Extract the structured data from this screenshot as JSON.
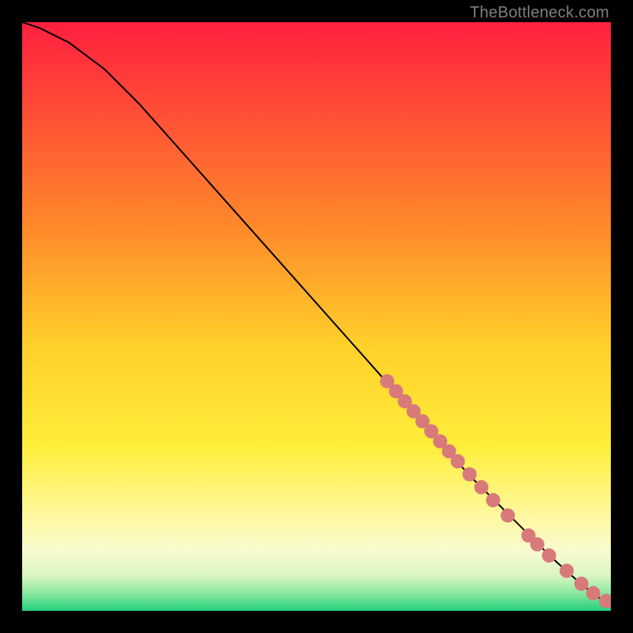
{
  "watermark": "TheBottleneck.com",
  "chart_data": {
    "type": "line",
    "title": "",
    "xlabel": "",
    "ylabel": "",
    "xlim": [
      0,
      100
    ],
    "ylim": [
      0,
      100
    ],
    "grid": false,
    "legend": false,
    "background_gradient": {
      "stops": [
        {
          "offset": 0,
          "color": "#ff1f3f"
        },
        {
          "offset": 35,
          "color": "#ff8a2a"
        },
        {
          "offset": 55,
          "color": "#ffd02a"
        },
        {
          "offset": 72,
          "color": "#ffee3a"
        },
        {
          "offset": 84,
          "color": "#fff8a0"
        },
        {
          "offset": 90,
          "color": "#f8fbd0"
        },
        {
          "offset": 94,
          "color": "#d9f5c0"
        },
        {
          "offset": 97,
          "color": "#8be8a0"
        },
        {
          "offset": 100,
          "color": "#20d07a"
        }
      ]
    },
    "curve": [
      {
        "x": 0,
        "y": 100
      },
      {
        "x": 3,
        "y": 99
      },
      {
        "x": 8,
        "y": 96.5
      },
      {
        "x": 14,
        "y": 92
      },
      {
        "x": 20,
        "y": 86
      },
      {
        "x": 28,
        "y": 77
      },
      {
        "x": 36,
        "y": 68
      },
      {
        "x": 44,
        "y": 59
      },
      {
        "x": 52,
        "y": 50
      },
      {
        "x": 60,
        "y": 41
      },
      {
        "x": 68,
        "y": 32
      },
      {
        "x": 76,
        "y": 23
      },
      {
        "x": 84,
        "y": 15
      },
      {
        "x": 90,
        "y": 9
      },
      {
        "x": 95,
        "y": 4.5
      },
      {
        "x": 98,
        "y": 2.2
      },
      {
        "x": 100,
        "y": 1.5
      }
    ],
    "markers": {
      "color": "#d97a7a",
      "radius_px": 9,
      "points": [
        {
          "x": 62,
          "y": 39.0
        },
        {
          "x": 63.5,
          "y": 37.3
        },
        {
          "x": 65,
          "y": 35.6
        },
        {
          "x": 66.5,
          "y": 33.9
        },
        {
          "x": 68,
          "y": 32.2
        },
        {
          "x": 69.5,
          "y": 30.5
        },
        {
          "x": 71,
          "y": 28.8
        },
        {
          "x": 72.5,
          "y": 27.1
        },
        {
          "x": 74,
          "y": 25.4
        },
        {
          "x": 76,
          "y": 23.2
        },
        {
          "x": 78,
          "y": 21.0
        },
        {
          "x": 80,
          "y": 18.8
        },
        {
          "x": 82.5,
          "y": 16.2
        },
        {
          "x": 86,
          "y": 12.8
        },
        {
          "x": 87.5,
          "y": 11.3
        },
        {
          "x": 89.5,
          "y": 9.4
        },
        {
          "x": 92.5,
          "y": 6.8
        },
        {
          "x": 95,
          "y": 4.6
        },
        {
          "x": 97,
          "y": 3.0
        },
        {
          "x": 99.2,
          "y": 1.7
        },
        {
          "x": 100.5,
          "y": 1.5
        }
      ]
    }
  }
}
